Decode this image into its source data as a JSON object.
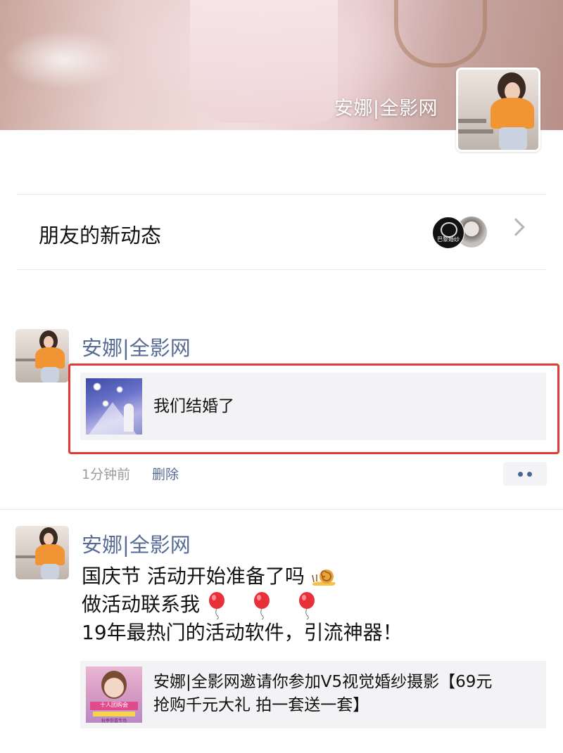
{
  "cover": {
    "name": "安娜|全影网"
  },
  "friends": {
    "label": "朋友的新动态",
    "badge_text": "巴黎婚纱"
  },
  "posts": [
    {
      "author": "安娜|全影网",
      "link_title": "我们结婚了",
      "time": "1分钟前",
      "delete_label": "删除"
    },
    {
      "author": "安娜|全影网",
      "text_lines": [
        "国庆节 活动开始准备了吗",
        "做活动联系我",
        "19年最热门的活动软件，引流神器！"
      ],
      "link_title_line1": "安娜|全影网邀请你参加V5视觉婚纱摄影【69元",
      "link_title_line2": "抢购千元大礼 拍一套送一套】",
      "thumb_banner": "十人团购会",
      "thumb_banner_sub": "秋季惊喜专场"
    }
  ],
  "colors": {
    "link_blue": "#576b95",
    "highlight_red": "#e53935"
  },
  "icons": [
    "chevron-right-icon",
    "more-dots-icon",
    "snail-emoji-icon",
    "balloon-emoji-icon"
  ]
}
